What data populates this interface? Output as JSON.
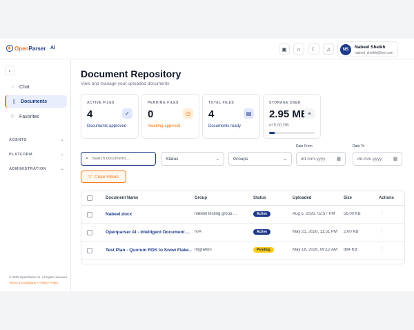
{
  "brand": {
    "name_open": "Open",
    "name_parser": "Parser",
    "product": "AI"
  },
  "header": {
    "icons": [
      "layout-icon",
      "headset-icon",
      "moon-icon",
      "bell-icon"
    ],
    "user": {
      "initials": "NS",
      "name": "Nabeel Sheikh",
      "email": "nabeel_sheikh@live.com"
    }
  },
  "sidebar": {
    "collapse_glyph": "‹",
    "items": [
      {
        "label": "Chat",
        "icon": "chat-icon",
        "glyph": "◌",
        "active": false
      },
      {
        "label": "Documents",
        "icon": "document-icon",
        "glyph": "▯",
        "active": true
      },
      {
        "label": "Favorites",
        "icon": "heart-icon",
        "glyph": "♡",
        "active": false
      }
    ],
    "sections": [
      "AGENTS",
      "PLATFORM",
      "ADMINISTRATION"
    ],
    "footer": {
      "copyright": "© 2026 OpenParser AI. All rights reserved.",
      "links": "Terms & Conditions • Privacy Policy"
    }
  },
  "page": {
    "title": "Document Repository",
    "subtitle": "View and manage your uploaded documents"
  },
  "stats": [
    {
      "label": "ACTIVE FILES",
      "value": "4",
      "note": "Documents approved",
      "note_color": "#1e3a8a",
      "icon": "check-circle-icon",
      "glyph": "✓",
      "icon_bg": "#e0e7ff",
      "icon_color": "#1e3a8a"
    },
    {
      "label": "PENDING FILES",
      "value": "0",
      "note": "Awaiting approval",
      "note_color": "#f97316",
      "icon": "clock-icon",
      "glyph": "◷",
      "icon_bg": "#ffedd5",
      "icon_color": "#f97316"
    },
    {
      "label": "TOTAL FILES",
      "value": "4",
      "note": "Documents ready",
      "note_color": "#1e3a8a",
      "icon": "file-icon",
      "glyph": "▤",
      "icon_bg": "#e0e7ff",
      "icon_color": "#1e3a8a"
    },
    {
      "label": "STORAGE USED",
      "value": "2.95 MB",
      "note": "of 5.00 GB",
      "note_color": "#6b7280",
      "icon": "menu-icon",
      "glyph": "≡",
      "icon_bg": "#f3f4f6",
      "icon_color": "#374151",
      "usage_fraction": 0.12
    }
  ],
  "filters": {
    "search_placeholder": "Search documents...",
    "status": "Status",
    "groups": "Groups",
    "date_from_label": "Date From",
    "date_to_label": "Date To",
    "date_placeholder": "dd-mm-yyyy",
    "clear_label": "Clear Filters"
  },
  "table": {
    "columns": [
      "Document Name",
      "Group",
      "Status",
      "Uploaded",
      "Size",
      "Actions"
    ],
    "rows": [
      {
        "name": "Nabeel.docx",
        "group": "nabeel testing group ...",
        "status": "Active",
        "uploaded": "Aug 5, 2026, 02:57 PM",
        "size": "56.00 KB"
      },
      {
        "name": "Openparser AI - Intelligent Document ...",
        "group": "N/A",
        "status": "Active",
        "uploaded": "May 21, 2026, 11:51 PM",
        "size": "2.00 KB"
      },
      {
        "name": "Test Plan - Quorum RDS to Snow Flake...",
        "group": "migration",
        "status": "Pending",
        "uploaded": "May 18, 2026, 09:12 AM",
        "size": "884 KB"
      }
    ],
    "status_colors": {
      "Active": {
        "bg": "#1e3a8a",
        "fg": "#ffffff"
      },
      "Pending": {
        "bg": "#facc15",
        "fg": "#1f2937"
      }
    }
  }
}
